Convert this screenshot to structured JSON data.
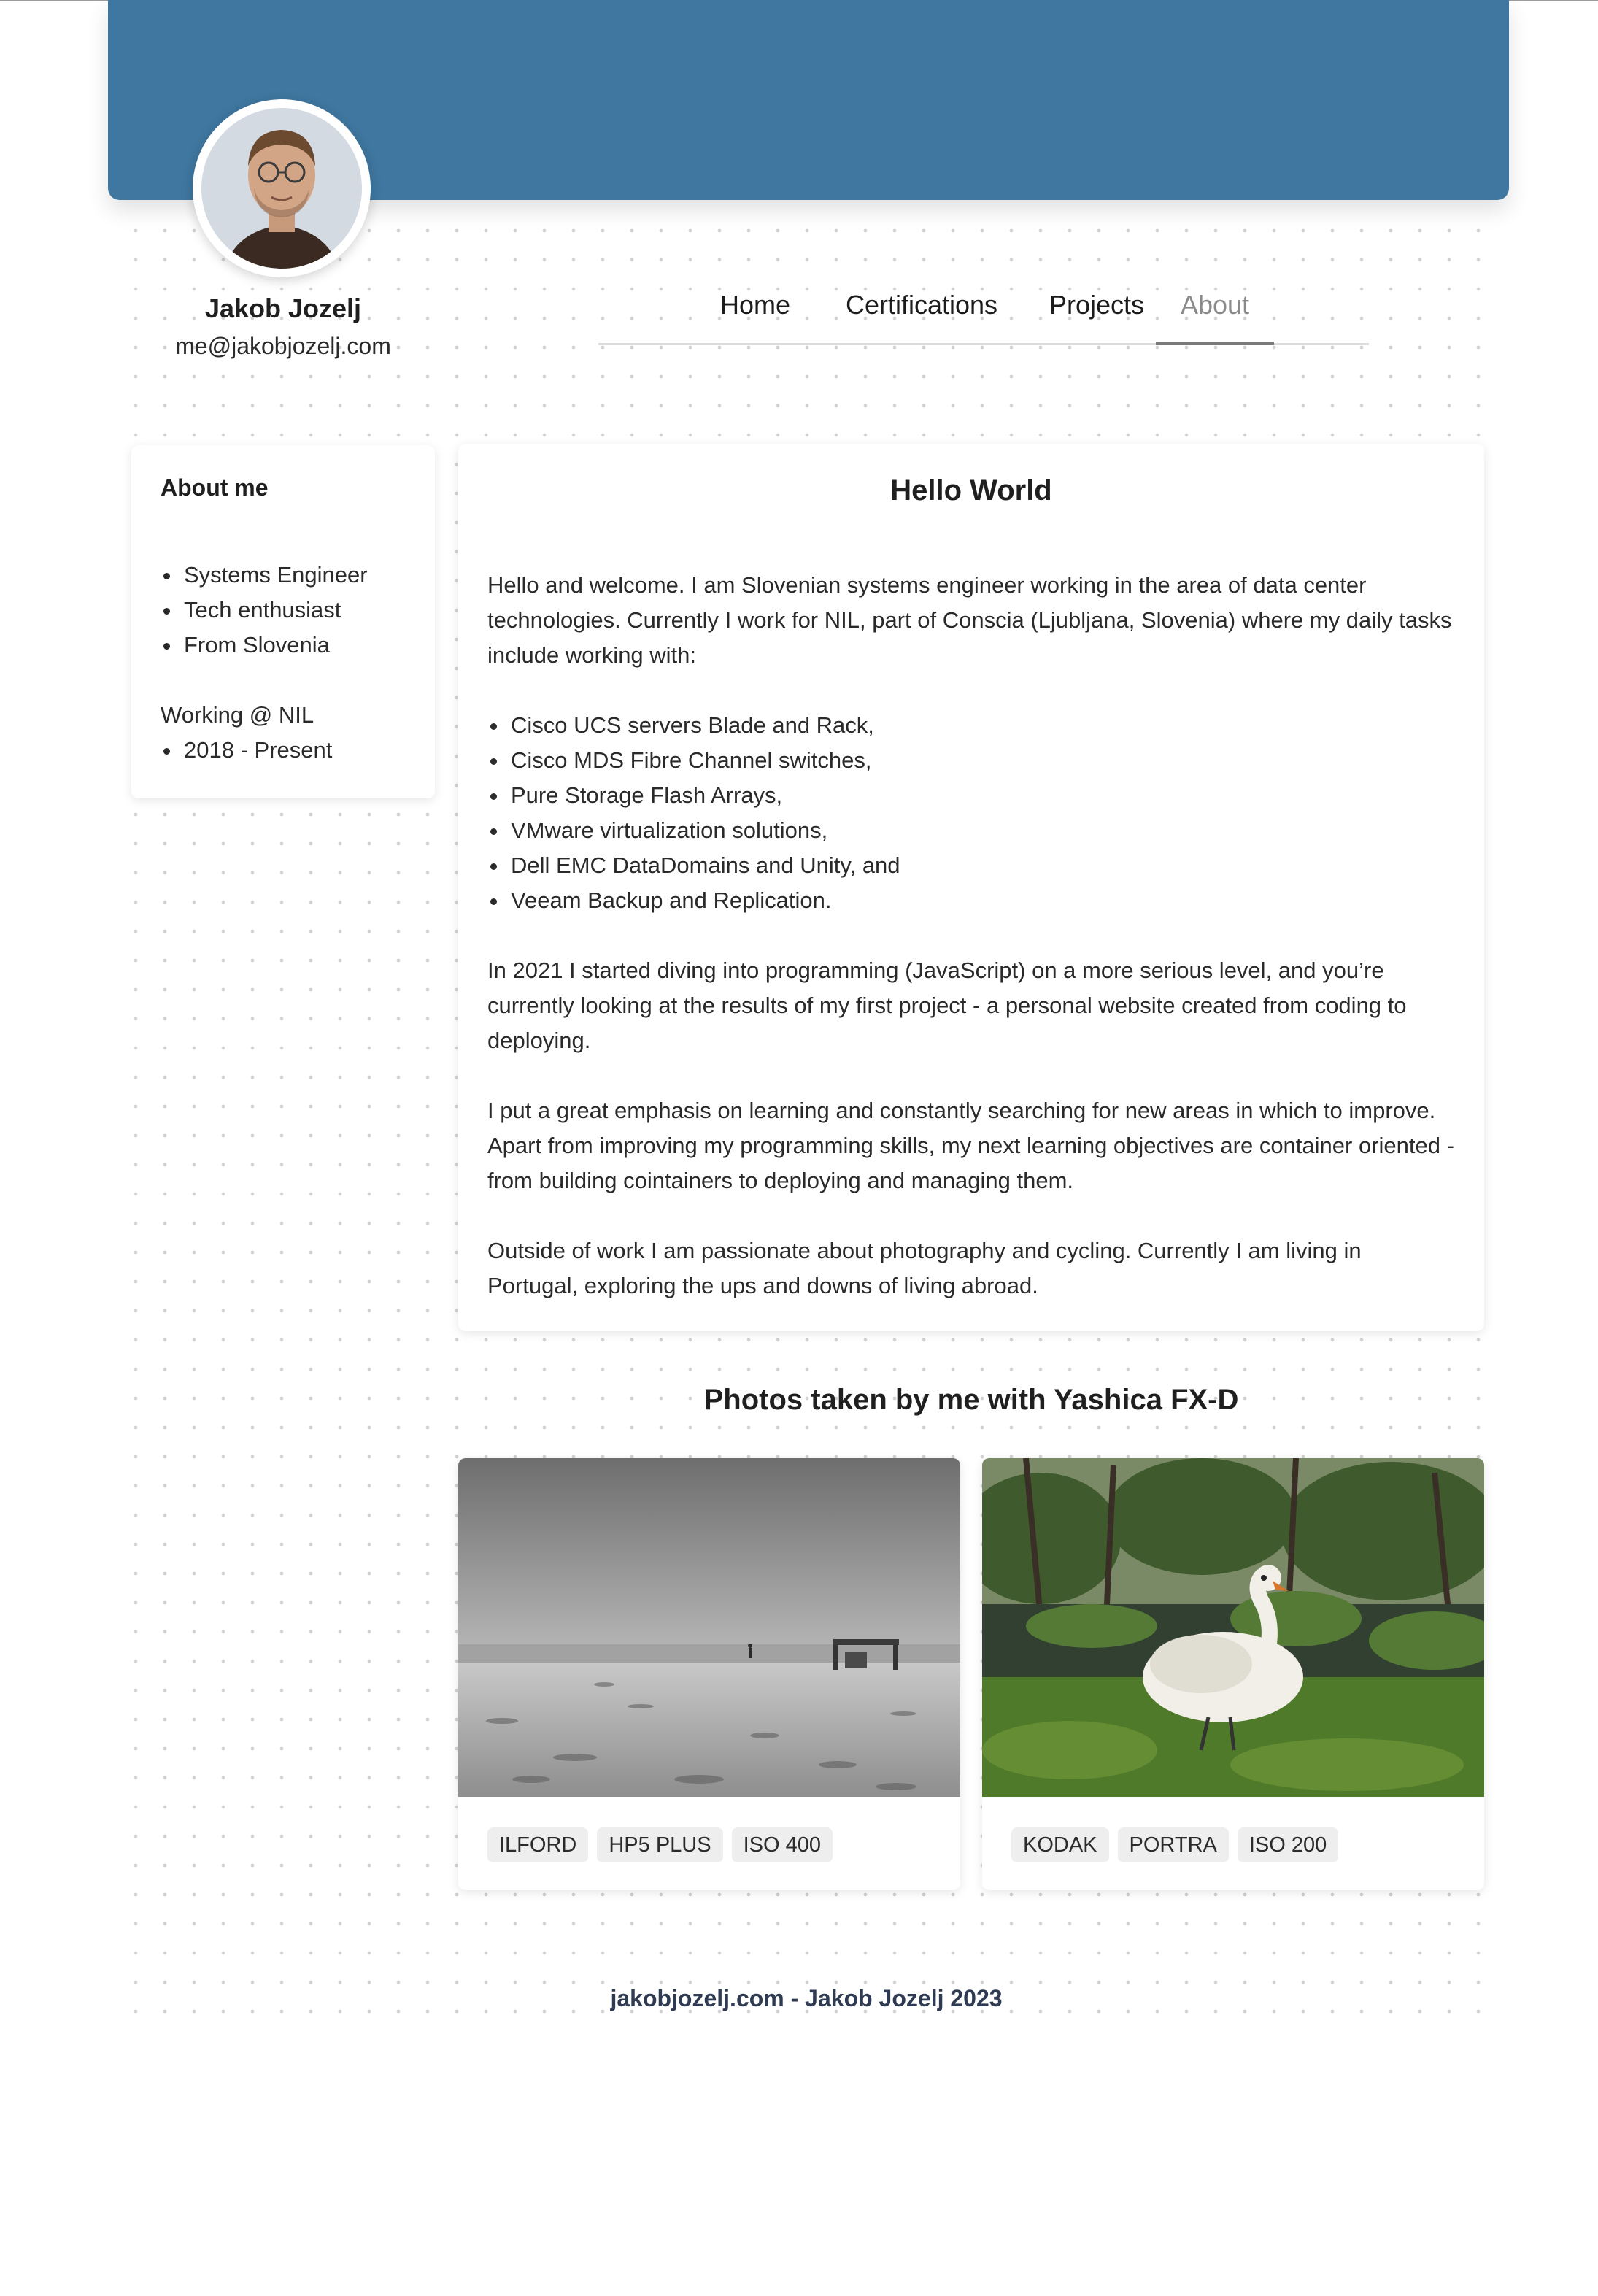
{
  "profile": {
    "name": "Jakob Jozelj",
    "email": "me@jakobjozelj.com"
  },
  "nav": {
    "items": [
      "Home",
      "Certifications",
      "Projects",
      "About"
    ],
    "active": "About"
  },
  "sidebar": {
    "title": "About me",
    "traits": [
      "Systems Engineer",
      "Tech enthusiast",
      "From Slovenia"
    ],
    "work_label": "Working @ NIL",
    "work_period": "2018 - Present"
  },
  "main": {
    "title": "Hello World",
    "intro": "Hello and welcome. I am Slovenian systems engineer working in the area of data center technologies. Currently I work for NIL, part of Conscia (Ljubljana, Slovenia) where my daily tasks include working with:",
    "skills": [
      "Cisco UCS servers Blade and Rack,",
      "Cisco MDS Fibre Channel switches,",
      "Pure Storage Flash Arrays,",
      "VMware virtualization solutions,",
      "Dell EMC DataDomains and Unity, and",
      "Veeam Backup and Replication."
    ],
    "para2": "In 2021 I started diving into programming (JavaScript) on a more serious level, and you’re currently looking at the results of my first project - a personal website created from coding to deploying.",
    "para3": "I put a great emphasis on learning and constantly searching for new areas in which to improve. Apart from improving my programming skills, my next learning objectives are container oriented - from building cointainers to deploying and managing them.",
    "para4": "Outside of work I am passionate about photography and cycling. Currently I am living in Portugal, exploring the ups and downs of living abroad."
  },
  "photos": {
    "heading": "Photos taken by me with Yashica FX-D",
    "items": [
      {
        "tags": [
          "ILFORD",
          "HP5 PLUS",
          "ISO 400"
        ]
      },
      {
        "tags": [
          "KODAK",
          "PORTRA",
          "ISO 200"
        ]
      }
    ]
  },
  "footer": {
    "text": "jakobjozelj.com - Jakob Jozelj 2023"
  }
}
